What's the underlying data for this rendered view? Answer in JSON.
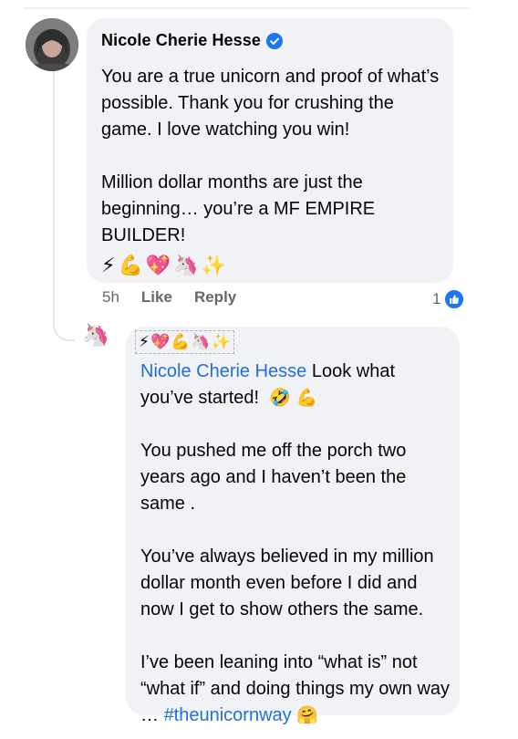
{
  "comment": {
    "author": "Nicole Cherie Hesse",
    "verified_icon": "verified-badge-icon",
    "paragraphs": [
      "You are a true unicorn and proof of what’s possible. Thank you for crushing the game. I love watching you win!",
      "Million dollar months are just the beginning… you’re a MF EMPIRE BUILDER!"
    ],
    "emoji_line": [
      "⚡",
      "💪",
      "💖",
      "🦄",
      "✨"
    ],
    "timestamp": "5h",
    "like_label": "Like",
    "reply_label": "Reply",
    "reaction_count": "1",
    "reaction_icon": "thumbs-up-icon",
    "colors": {
      "bubble": "#f0f2f5",
      "meta": "#65676b",
      "like_blue": "#1877f2"
    }
  },
  "reply": {
    "avatar_emoji": "🦄",
    "emoji_line": [
      "⚡",
      "💖",
      "💪",
      "🦄",
      "✨"
    ],
    "mention": "Nicole Cherie Hesse",
    "line1_rest": " Look what you’ve started!",
    "line1_emoji_1": "🤣",
    "line1_emoji_2": "💪",
    "paragraph2": "You pushed me off the porch two years ago and I haven’t been the same .",
    "paragraph3": "You’ve always believed in my million dollar month even before I did and now I get to show others  the same.",
    "paragraph4_text": "I’ve been leaning into “what is” not “what if” and doing things my own way …",
    "hashtag": "#theunicornway",
    "end_emoji": "🤗",
    "colors": {
      "link": "#216fdb"
    }
  }
}
